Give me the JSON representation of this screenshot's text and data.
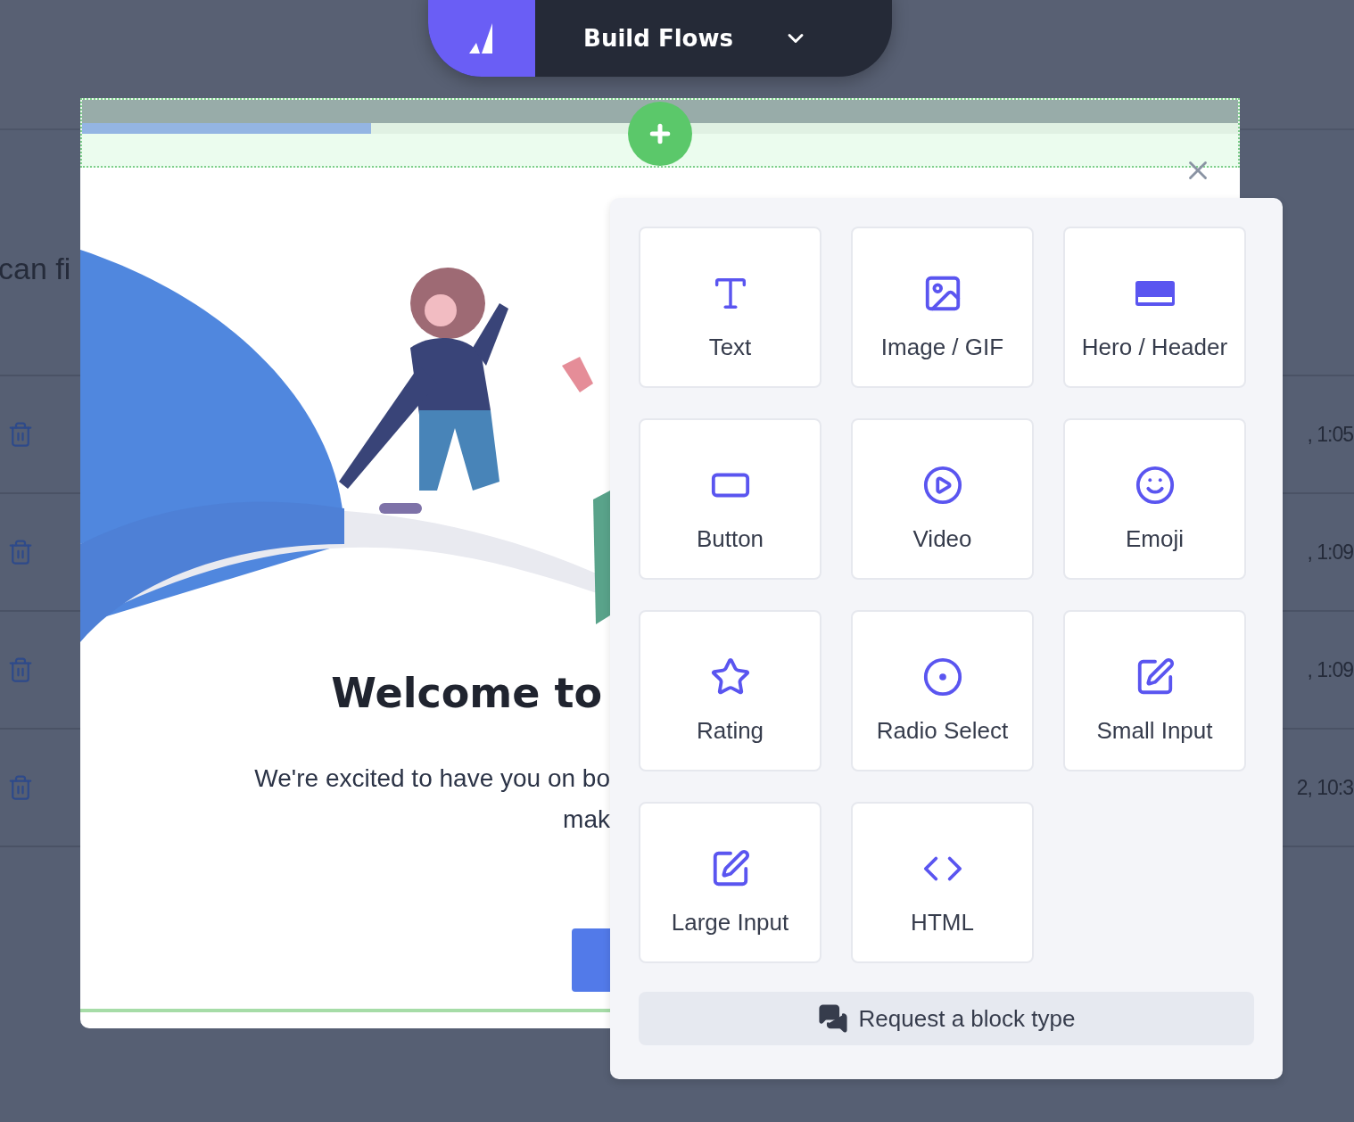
{
  "top_bar": {
    "title": "Build Flows"
  },
  "background_page": {
    "intro_text": "can fi",
    "rows": [
      {
        "time": ", 1:05"
      },
      {
        "time": ", 1:09"
      },
      {
        "time": ", 1:09"
      },
      {
        "time": "2, 10:3"
      }
    ]
  },
  "modal": {
    "progress": {
      "level": 0.25
    },
    "heading": "Welcome to",
    "body_lines": [
      "We're excited to have you on bo",
      "mak"
    ]
  },
  "block_picker": {
    "blocks": [
      {
        "kind": "text",
        "label": "Text"
      },
      {
        "kind": "image",
        "label": "Image / GIF"
      },
      {
        "kind": "hero",
        "label": "Hero / Header"
      },
      {
        "kind": "button",
        "label": "Button"
      },
      {
        "kind": "video",
        "label": "Video"
      },
      {
        "kind": "emoji",
        "label": "Emoji"
      },
      {
        "kind": "rating",
        "label": "Rating"
      },
      {
        "kind": "radio",
        "label": "Radio Select"
      },
      {
        "kind": "small_input",
        "label": "Small Input"
      },
      {
        "kind": "large_input",
        "label": "Large Input"
      },
      {
        "kind": "html",
        "label": "HTML"
      }
    ],
    "request_button": "Request a block type"
  }
}
